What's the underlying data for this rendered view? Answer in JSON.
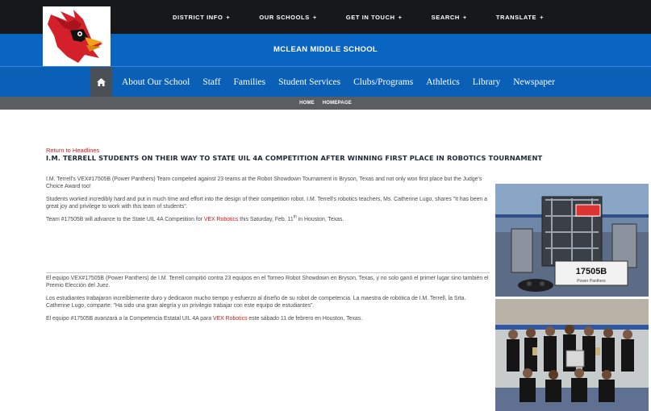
{
  "top_nav": [
    {
      "label": "DISTRICT INFO",
      "plus": "+"
    },
    {
      "label": "OUR SCHOOLS",
      "plus": "+"
    },
    {
      "label": "GET IN TOUCH",
      "plus": "+"
    },
    {
      "label": "SEARCH",
      "plus": "+"
    },
    {
      "label": "TRANSLATE",
      "plus": "+"
    }
  ],
  "school_name": "MCLEAN MIDDLE SCHOOL",
  "main_nav": [
    "About Our School",
    "Staff",
    "Families",
    "Student Services",
    "Clubs/Programs",
    "Athletics",
    "Library",
    "Newspaper"
  ],
  "breadcrumb": [
    "HOME",
    "HOMEPAGE"
  ],
  "article": {
    "return_link": "Return to Headlines",
    "headline": "I.M. TERRELL STUDENTS ON THEIR WAY TO STATE UIL 4A COMPETITION AFTER WINNING FIRST PLACE IN ROBOTICS TOURNAMENT",
    "en_p1": "I.M. Terrell's VEX#17505B (Power Panthers) Team competed against 23 teams at the Robot Showdown Tournament in Bryson, Texas and not only won first place but the Judge's Choice Award too!",
    "en_p2": "Students worked incredibly hard and put in much time and effort into the design of their competition robot. I.M. Terrell's robotics teachers, Ms. Catherine Lugo, shares \"It has been a great joy and privilege to work with this team of students\".",
    "en_p3_pre": "Team #17505B will advance to the State UIL 4A Competition for ",
    "en_p3_link": "VEX Robotics",
    "en_p3_mid": " this Saturday, Feb. 11",
    "en_p3_sup": "th",
    "en_p3_post": " in Houston, Texas.",
    "es_p1": "El equipo VEX#17505B (Power Panthers) de I.M. Terrell compitió contra 23 equipos en el Torneo Robot Showdown en Bryson, Texas, y no solo ganó el primer lugar sino también el Premio Elección del Juez.",
    "es_p2": "Los estudiantes trabajaron increíblemente duro y dedicaron mucho tiempo y esfuerzo al diseño de su robot de competencia. La maestra de robótica de I.M. Terrell, la Srta. Catherine Lugo, comparte: \"Ha sido una gran alegría y un privilegio trabajar con este equipo de estudiantes\".",
    "es_p3_pre": "El equipo #17505B avanzará a la Competencia Estatal UIL 4A para ",
    "es_p3_link": "VEX Robotics",
    "es_p3_post": " este sábado 11 de febrero en Houston, Texas."
  },
  "photo1": {
    "sign_text": "17505B",
    "sub_text": "Power Panthers"
  },
  "colors": {
    "top_bar": "#16181c",
    "school_band": "#0a64c2",
    "main_nav": "#0a5fb7",
    "breadcrumb_bar": "#5a5d62",
    "link_red": "#d11a1a"
  }
}
